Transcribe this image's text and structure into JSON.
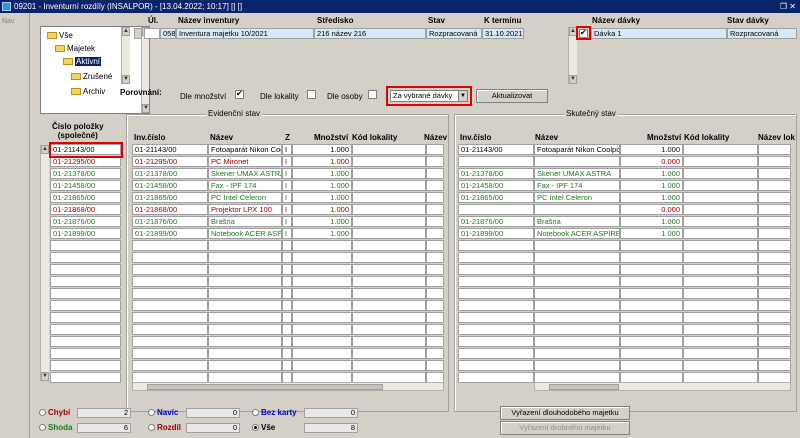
{
  "window": {
    "title": "09201 - Inventurní rozdíly (INSALPOR) - [13.04.2022; 10:17] [] []",
    "controls": "❐ ✕"
  },
  "nav": {
    "label": "Nav"
  },
  "tree": {
    "items": [
      "Vše",
      "Majetek",
      "Aktivní",
      "Zrušené",
      "Archiv"
    ]
  },
  "inventory": {
    "headers": {
      "ul": "Úl.",
      "name": "Název inventury",
      "center": "Středisko",
      "state": "Stav",
      "deadline": "K termínu"
    },
    "row": {
      "ul": "058",
      "name": "Inventura majetku 10/2021",
      "center": "216 název 216",
      "state": "Rozpracovaná",
      "deadline": "31.10.2021"
    }
  },
  "batches": {
    "headers": {
      "name": "Název dávky",
      "state": "Stav dávky"
    },
    "row": {
      "name": "Dávka 1",
      "state": "Rozpracovaná"
    }
  },
  "compare": {
    "label": "Porovnání:",
    "qty": "Dle množství",
    "loc": "Dle lokality",
    "person": "Dle osoby",
    "select_value": "Za vybrané dávky",
    "refresh": "Aktualizovat"
  },
  "section_titles": {
    "evid": "Evidenční stav",
    "actual": "Skutečný stav"
  },
  "item_header": "Číslo položky\n(společné)",
  "evid_headers": {
    "inv": "Inv.číslo",
    "name": "Název",
    "z": "Z",
    "qty": "Množství",
    "loc": "Kód lokality",
    "locname": "Název"
  },
  "actual_headers": {
    "inv": "Inv.číslo",
    "name": "Název",
    "qty": "Množství",
    "loc": "Kód lokality",
    "locname": "Název lok"
  },
  "rows": [
    {
      "item": "01-21143/00",
      "inv": "01-21143/00",
      "name": "Fotoaparát Nikon Coo",
      "z": "I",
      "qty": "1.000",
      "ainv": "01-21143/00",
      "aname": "Fotoaparát Nikon Coolpix",
      "aqty": "1.000",
      "color": "black"
    },
    {
      "item": "01-21295/00",
      "inv": "01-21295/00",
      "name": "PC Mironet",
      "z": "I",
      "qty": "1.000",
      "ainv": "",
      "aname": "",
      "aqty": "0.000",
      "color": "red"
    },
    {
      "item": "01-21378/00",
      "inv": "01-21378/00",
      "name": "Skener UMAX ASTRA",
      "z": "I",
      "qty": "1.000",
      "ainv": "01-21378/00",
      "aname": "Skener UMAX ASTRA",
      "aqty": "1.000",
      "color": "green"
    },
    {
      "item": "01-21458/00",
      "inv": "01-21458/00",
      "name": "Fax - IPF 174",
      "z": "I",
      "qty": "1.000",
      "ainv": "01-21458/00",
      "aname": "Fax - IPF 174",
      "aqty": "1.000",
      "color": "green"
    },
    {
      "item": "01-21865/00",
      "inv": "01-21865/00",
      "name": "PC Intel Celeron",
      "z": "I",
      "qty": "1.000",
      "ainv": "01-21865/00",
      "aname": "PC Intel Celeron",
      "aqty": "1.000",
      "color": "green"
    },
    {
      "item": "01-21868/00",
      "inv": "01-21868/00",
      "name": "Projektor LPX 100",
      "z": "I",
      "qty": "1.000",
      "ainv": "",
      "aname": "",
      "aqty": "0.000",
      "color": "red"
    },
    {
      "item": "01-21876/00",
      "inv": "01-21876/00",
      "name": "Brašna",
      "z": "I",
      "qty": "1.000",
      "ainv": "01-21876/00",
      "aname": "Brašna",
      "aqty": "1.000",
      "color": "green"
    },
    {
      "item": "01-21899/00",
      "inv": "01-21899/00",
      "name": "Notebook ACER ASP",
      "z": "I",
      "qty": "1.000",
      "ainv": "01-21899/00",
      "aname": "Notebook ACER ASPIRE",
      "aqty": "1.000",
      "color": "green"
    }
  ],
  "filters": {
    "chyby": {
      "label": "Chybí",
      "value": "2"
    },
    "shoda": {
      "label": "Shoda",
      "value": "6"
    },
    "navic": {
      "label": "Navíc",
      "value": "0"
    },
    "rozdil": {
      "label": "Rozdíl",
      "value": "0"
    },
    "bezkarty": {
      "label": "Bez karty",
      "value": "0"
    },
    "vse": {
      "label": "Vše",
      "value": "8"
    }
  },
  "actions": {
    "longterm": "Vyřazení dlouhodobého majetku",
    "small": "Vyřazení drobného majetku"
  },
  "colors": {
    "red": "#a00000",
    "green": "#1a7a1a",
    "black": "#000000",
    "highlight": "#e00000",
    "titlebar": "#0a246a"
  }
}
